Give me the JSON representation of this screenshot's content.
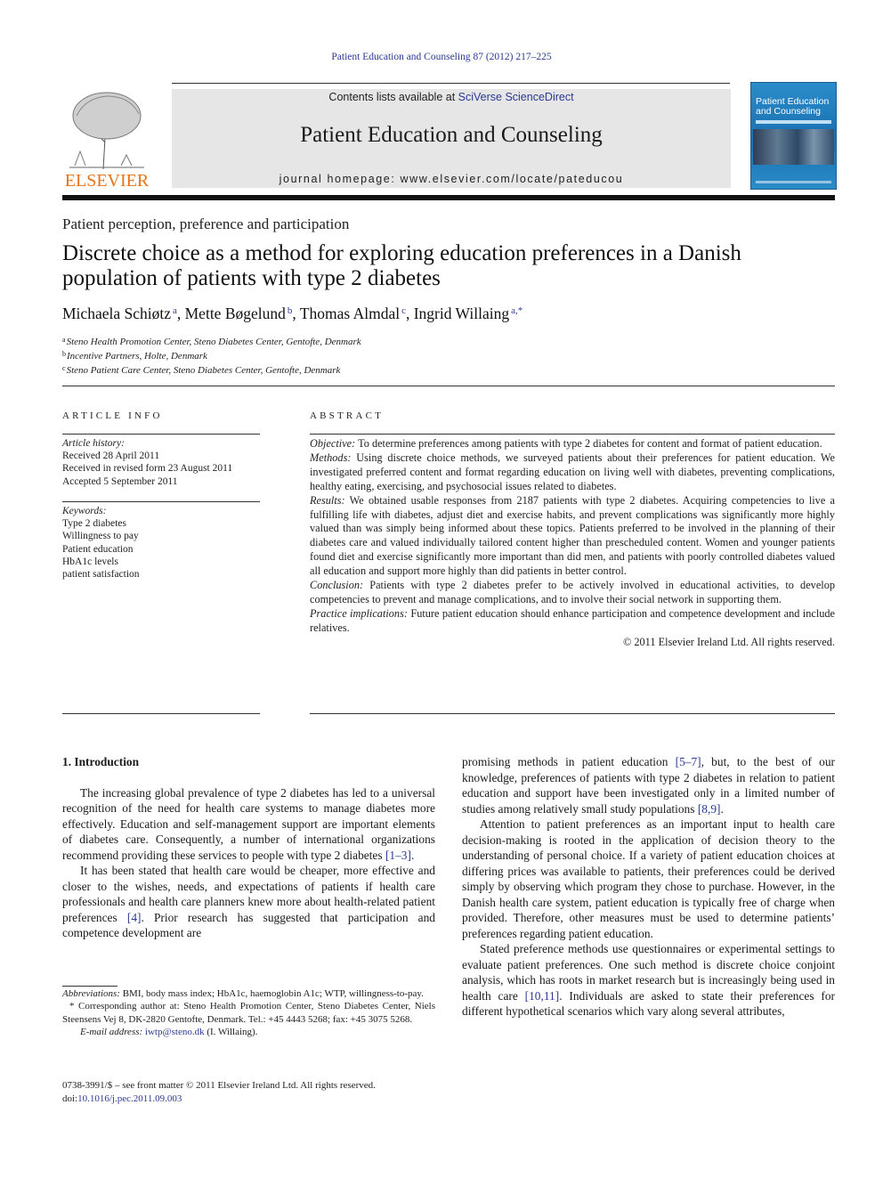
{
  "running_head": "Patient Education and Counseling 87 (2012) 217–225",
  "masthead": {
    "publisher_logo_text": "ELSEVIER",
    "contents_prefix": "Contents lists available at ",
    "contents_link": "SciVerse ScienceDirect",
    "journal_title": "Patient Education and Counseling",
    "homepage_prefix": "journal homepage: ",
    "homepage_url": "www.elsevier.com/locate/pateducou",
    "cover_title_line1": "Patient Education",
    "cover_title_line2": "and Counseling"
  },
  "article": {
    "section": "Patient perception, preference and participation",
    "title": "Discrete choice as a method for exploring education preferences in a Danish population of patients with type 2 diabetes",
    "authors": [
      {
        "name": "Michaela Schiøtz",
        "sup": "a"
      },
      {
        "name": "Mette Bøgelund",
        "sup": "b"
      },
      {
        "name": "Thomas Almdal",
        "sup": "c"
      },
      {
        "name": "Ingrid Willaing",
        "sup": "a,*"
      }
    ],
    "affiliations": [
      {
        "sup": "a",
        "text": "Steno Health Promotion Center, Steno Diabetes Center, Gentofte, Denmark"
      },
      {
        "sup": "b",
        "text": "Incentive Partners, Holte, Denmark"
      },
      {
        "sup": "c",
        "text": "Steno Patient Care Center, Steno Diabetes Center, Gentofte, Denmark"
      }
    ]
  },
  "article_info": {
    "heading": "ARTICLE INFO",
    "history_label": "Article history:",
    "history": [
      "Received 28 April 2011",
      "Received in revised form 23 August 2011",
      "Accepted 5 September 2011"
    ],
    "keywords_label": "Keywords:",
    "keywords": [
      "Type 2 diabetes",
      "Willingness to pay",
      "Patient education",
      "HbA1c levels",
      "patient satisfaction"
    ]
  },
  "abstract": {
    "heading": "ABSTRACT",
    "sections": [
      {
        "label": "Objective:",
        "text": " To determine preferences among patients with type 2 diabetes for content and format of patient education."
      },
      {
        "label": "Methods:",
        "text": " Using discrete choice methods, we surveyed patients about their preferences for patient education. We investigated preferred content and format regarding education on living well with diabetes, preventing complications, healthy eating, exercising, and psychosocial issues related to diabetes."
      },
      {
        "label": "Results:",
        "text": " We obtained usable responses from 2187 patients with type 2 diabetes. Acquiring competencies to live a fulfilling life with diabetes, adjust diet and exercise habits, and prevent complications was significantly more highly valued than was simply being informed about these topics. Patients preferred to be involved in the planning of their diabetes care and valued individually tailored content higher than prescheduled content. Women and younger patients found diet and exercise significantly more important than did men, and patients with poorly controlled diabetes valued all education and support more highly than did patients in better control."
      },
      {
        "label": "Conclusion:",
        "text": " Patients with type 2 diabetes prefer to be actively involved in educational activities, to develop competencies to prevent and manage complications, and to involve their social network in supporting them."
      },
      {
        "label": "Practice implications:",
        "text": " Future patient education should enhance participation and competence development and include relatives."
      }
    ],
    "copyright": "© 2011 Elsevier Ireland Ltd. All rights reserved."
  },
  "body": {
    "section_heading": "1.  Introduction",
    "left_paragraphs": [
      {
        "parts": [
          {
            "t": "The increasing global prevalence of type 2 diabetes has led to a universal recognition of the need for health care systems to manage diabetes more effectively. Education and self-management support are important elements of diabetes care. Consequently, a number of international organizations recommend providing these services to people with type 2 diabetes "
          },
          {
            "ref": "[1–3]"
          },
          {
            "t": "."
          }
        ]
      },
      {
        "parts": [
          {
            "t": "It has been stated that health care would be cheaper, more effective and closer to the wishes, needs, and expectations of patients if health care professionals and health care planners knew more about health-related patient preferences "
          },
          {
            "ref": "[4]"
          },
          {
            "t": ". Prior research has suggested that participation and competence development are"
          }
        ]
      }
    ],
    "right_paragraphs": [
      {
        "continued": true,
        "parts": [
          {
            "t": "promising methods in patient education "
          },
          {
            "ref": "[5–7]"
          },
          {
            "t": ", but, to the best of our knowledge, preferences of patients with type 2 diabetes in relation to patient education and support have been investigated only in a limited number of studies among relatively small study populations "
          },
          {
            "ref": "[8,9]"
          },
          {
            "t": "."
          }
        ]
      },
      {
        "parts": [
          {
            "t": "Attention to patient preferences as an important input to health care decision-making is rooted in the application of decision theory to the understanding of personal choice. If a variety of patient education choices at differing prices was available to patients, their preferences could be derived simply by observing which program they chose to purchase. However, in the Danish health care system, patient education is typically free of charge when provided. Therefore, other measures must be used to determine patients’ preferences regarding patient education."
          }
        ]
      },
      {
        "parts": [
          {
            "t": "Stated preference methods use questionnaires or experimental settings to evaluate patient preferences. One such method is discrete choice conjoint analysis, which has roots in market research but is increasingly being used in health care "
          },
          {
            "ref": "[10,11]"
          },
          {
            "t": ". Individuals are asked to state their preferences for different hypothetical scenarios which vary along several attributes,"
          }
        ]
      }
    ]
  },
  "footnotes": {
    "abbreviations_label": "Abbreviations:",
    "abbreviations_text": " BMI, body mass index; HbA1c, haemoglobin A1c; WTP, willingness-to-pay.",
    "corresponding": "* Corresponding author at: Steno Health Promotion Center, Steno Diabetes Center, Niels Steensens Vej 8, DK-2820 Gentofte, Denmark. Tel.: +45 4443 5268; fax: +45 3075 5268.",
    "email_label": "E-mail address:",
    "email": "iwtp@steno.dk",
    "email_suffix": " (I. Willaing)."
  },
  "front_matter": {
    "issn_line": "0738-3991/$ – see front matter © 2011 Elsevier Ireland Ltd. All rights reserved.",
    "doi_prefix": "doi:",
    "doi": "10.1016/j.pec.2011.09.003"
  },
  "colors": {
    "link": "#2b3990",
    "elsevier_orange": "#e8731a",
    "masthead_bg": "#e6e6e6",
    "cover_blue": "#1a6fb0"
  }
}
